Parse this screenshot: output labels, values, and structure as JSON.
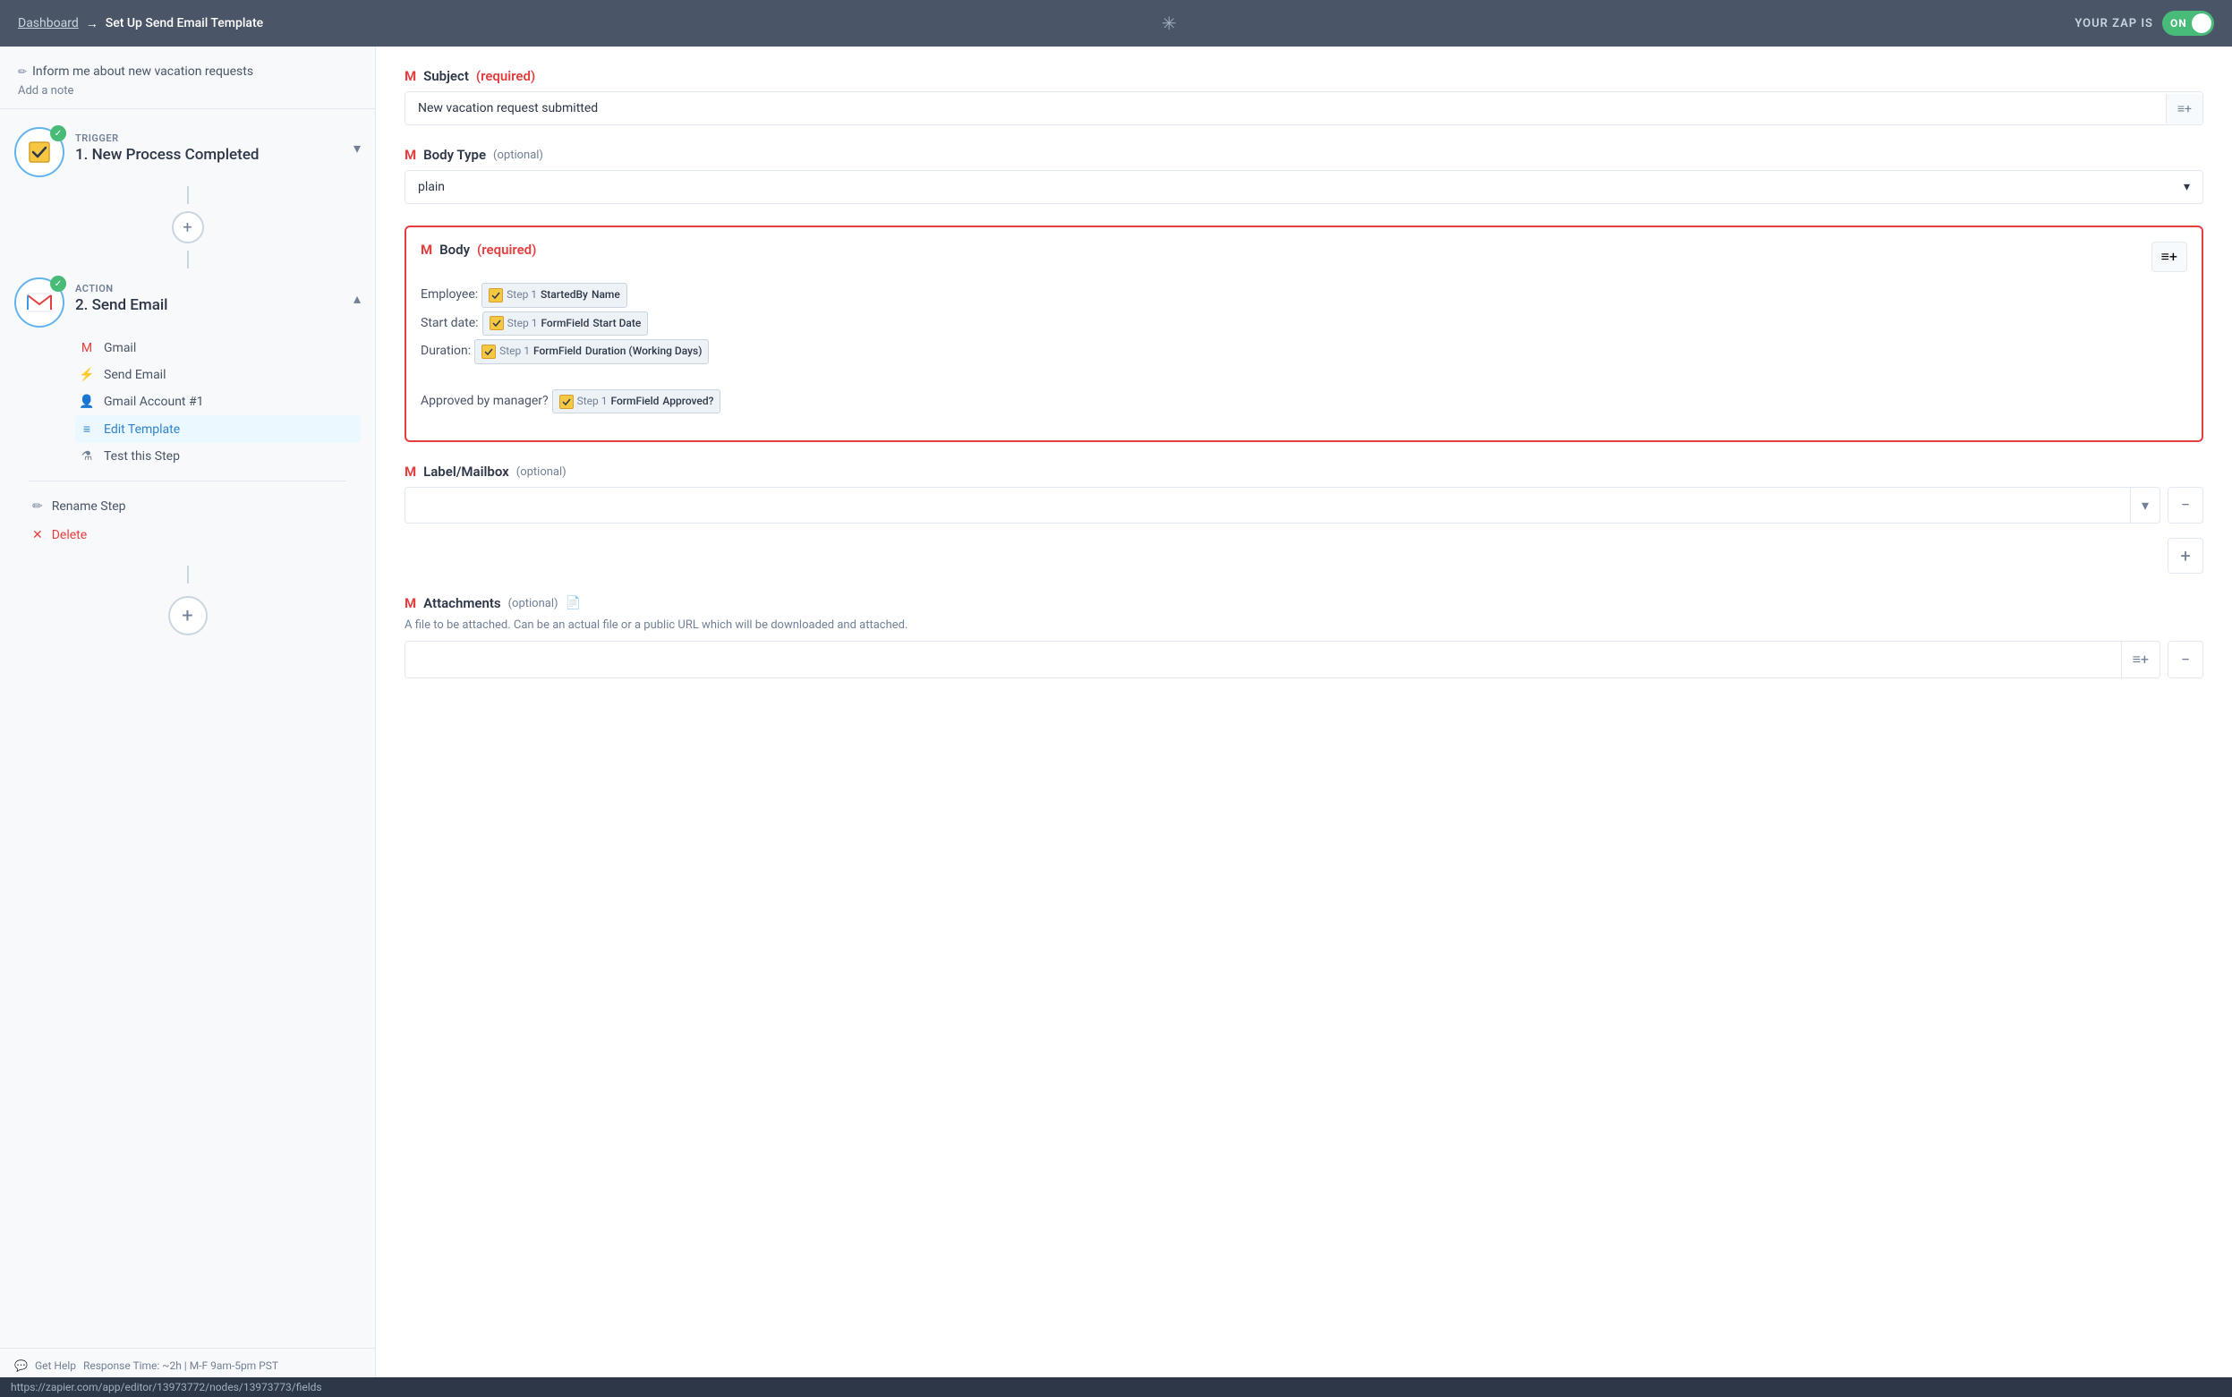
{
  "topnav": {
    "dashboard_label": "Dashboard",
    "arrow": "→",
    "page_title": "Set Up Send Email Template",
    "logo": "✳",
    "zap_status_label": "YOUR ZAP IS",
    "toggle_label": "ON"
  },
  "sidebar": {
    "workflow_title": "Inform me about new vacation requests",
    "add_note": "Add a note",
    "trigger": {
      "badge": "TRIGGER",
      "title": "1. New Process Completed",
      "check": "✓"
    },
    "action": {
      "badge": "ACTION",
      "title": "2. Send Email",
      "check": "✓",
      "sub_items": [
        {
          "id": "gmail",
          "icon": "M",
          "label": "Gmail"
        },
        {
          "id": "send-email",
          "icon": "⚡",
          "label": "Send Email"
        },
        {
          "id": "gmail-account",
          "icon": "👤",
          "label": "Gmail Account #1"
        },
        {
          "id": "edit-template",
          "icon": "≡",
          "label": "Edit Template",
          "active": true
        },
        {
          "id": "test-step",
          "icon": "⚗",
          "label": "Test this Step"
        }
      ],
      "extra_items": [
        {
          "id": "rename",
          "icon": "✏",
          "label": "Rename Step"
        },
        {
          "id": "delete",
          "icon": "✕",
          "label": "Delete",
          "danger": true
        }
      ]
    }
  },
  "form": {
    "subject": {
      "label": "Subject",
      "required": "required",
      "value": "New vacation request submitted"
    },
    "body_type": {
      "label": "Body Type",
      "optional": "(optional)",
      "value": "plain"
    },
    "body": {
      "label": "Body",
      "required": "required",
      "rows": [
        {
          "prefix": "Employee:",
          "tokens": [
            {
              "step": "Step 1",
              "field": "StartedBy",
              "field2": "Name"
            }
          ]
        },
        {
          "prefix": "Start date:",
          "tokens": [
            {
              "step": "Step 1",
              "field": "FormField",
              "field2": "Start Date"
            }
          ]
        },
        {
          "prefix": "Duration:",
          "tokens": [
            {
              "step": "Step 1",
              "field": "FormField",
              "field2": "Duration (Working Days)"
            }
          ]
        },
        {
          "prefix": "",
          "tokens": []
        },
        {
          "prefix": "Approved by manager?",
          "tokens": [
            {
              "step": "Step 1",
              "field": "FormField",
              "field2": "Approved?"
            }
          ]
        }
      ]
    },
    "label_mailbox": {
      "label": "Label/Mailbox",
      "optional": "(optional)"
    },
    "attachments": {
      "label": "Attachments",
      "optional": "(optional)",
      "description": "A file to be attached. Can be an actual file or a public URL which will be downloaded and attached."
    }
  },
  "status_bar": {
    "url": "https://zapier.com/app/editor/13973772/nodes/13973773/fields"
  }
}
